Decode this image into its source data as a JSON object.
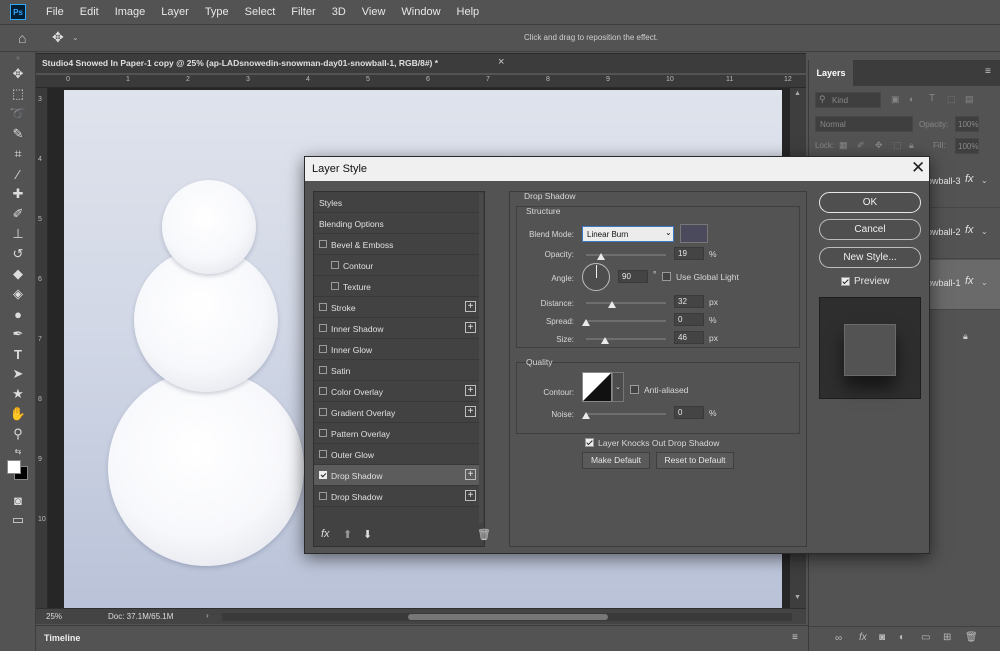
{
  "menu": [
    "File",
    "Edit",
    "Image",
    "Layer",
    "Type",
    "Select",
    "Filter",
    "3D",
    "View",
    "Window",
    "Help"
  ],
  "app_logo": "Ps",
  "options_bar": {
    "hint": "Click and drag to reposition the effect."
  },
  "document": {
    "tab_title": "Studio4 Snowed In Paper-1 copy @ 25% (ap-LADsnowedin-snowman-day01-snowball-1, RGB/8#) *",
    "close": "×",
    "ruler_top": [
      "0",
      "1",
      "2",
      "3",
      "4",
      "5",
      "6",
      "7",
      "8",
      "9",
      "10",
      "11",
      "12"
    ],
    "ruler_left": [
      "3",
      "4",
      "5",
      "6",
      "7",
      "8",
      "9",
      "10"
    ],
    "zoom": "25%",
    "doc_size": "Doc: 37.1M/65.1M"
  },
  "timeline": {
    "label": "Timeline"
  },
  "layers_panel": {
    "tab": "Layers",
    "kind": "Kind",
    "blend": "Normal",
    "opacity_label": "Opacity:",
    "opacity_value": "100%",
    "lock_label": "Lock:",
    "fill_label": "Fill:",
    "fill_value": "100%",
    "layers": [
      {
        "name": "owball-3",
        "fx": "fx"
      },
      {
        "name": "owball-2",
        "fx": "fx"
      },
      {
        "name": "owball-1",
        "fx": "fx"
      }
    ]
  },
  "dialog": {
    "title": "Layer Style",
    "close": "✕",
    "styles": [
      {
        "label": "Styles",
        "checkbox": false,
        "plus": false,
        "indent": 0
      },
      {
        "label": "Blending Options",
        "checkbox": false,
        "plus": false,
        "indent": 0
      },
      {
        "label": "Bevel & Emboss",
        "checkbox": true,
        "checked": false,
        "plus": false,
        "indent": 0
      },
      {
        "label": "Contour",
        "checkbox": true,
        "checked": false,
        "plus": false,
        "indent": 1
      },
      {
        "label": "Texture",
        "checkbox": true,
        "checked": false,
        "plus": false,
        "indent": 1
      },
      {
        "label": "Stroke",
        "checkbox": true,
        "checked": false,
        "plus": true,
        "indent": 0
      },
      {
        "label": "Inner Shadow",
        "checkbox": true,
        "checked": false,
        "plus": true,
        "indent": 0
      },
      {
        "label": "Inner Glow",
        "checkbox": true,
        "checked": false,
        "plus": false,
        "indent": 0
      },
      {
        "label": "Satin",
        "checkbox": true,
        "checked": false,
        "plus": false,
        "indent": 0
      },
      {
        "label": "Color Overlay",
        "checkbox": true,
        "checked": false,
        "plus": true,
        "indent": 0
      },
      {
        "label": "Gradient Overlay",
        "checkbox": true,
        "checked": false,
        "plus": true,
        "indent": 0
      },
      {
        "label": "Pattern Overlay",
        "checkbox": true,
        "checked": false,
        "plus": false,
        "indent": 0
      },
      {
        "label": "Outer Glow",
        "checkbox": true,
        "checked": false,
        "plus": false,
        "indent": 0
      },
      {
        "label": "Drop Shadow",
        "checkbox": true,
        "checked": true,
        "plus": true,
        "indent": 0,
        "selected": true
      },
      {
        "label": "Drop Shadow",
        "checkbox": true,
        "checked": false,
        "plus": true,
        "indent": 0
      }
    ],
    "footer_fx": "fx",
    "drop_shadow": {
      "title": "Drop Shadow",
      "structure_title": "Structure",
      "blend_mode_label": "Blend Mode:",
      "blend_mode_value": "Linear Burn",
      "shadow_color": "#4a4a5c",
      "opacity_label": "Opacity:",
      "opacity_value": "19",
      "opacity_fraction": 0.19,
      "angle_label": "Angle:",
      "angle_value": "90",
      "angle_unit": "°",
      "global_light_label": "Use Global Light",
      "distance_label": "Distance:",
      "distance_value": "32",
      "spread_label": "Spread:",
      "spread_value": "0",
      "size_label": "Size:",
      "size_value": "46",
      "quality_title": "Quality",
      "contour_label": "Contour:",
      "anti_aliased_label": "Anti-aliased",
      "noise_label": "Noise:",
      "noise_value": "0",
      "knocks_out_label": "Layer Knocks Out Drop Shadow",
      "make_default": "Make Default",
      "reset_default": "Reset to Default",
      "pct": "%",
      "px": "px"
    },
    "buttons": {
      "ok": "OK",
      "cancel": "Cancel",
      "new_style": "New Style...",
      "preview": "Preview"
    }
  }
}
